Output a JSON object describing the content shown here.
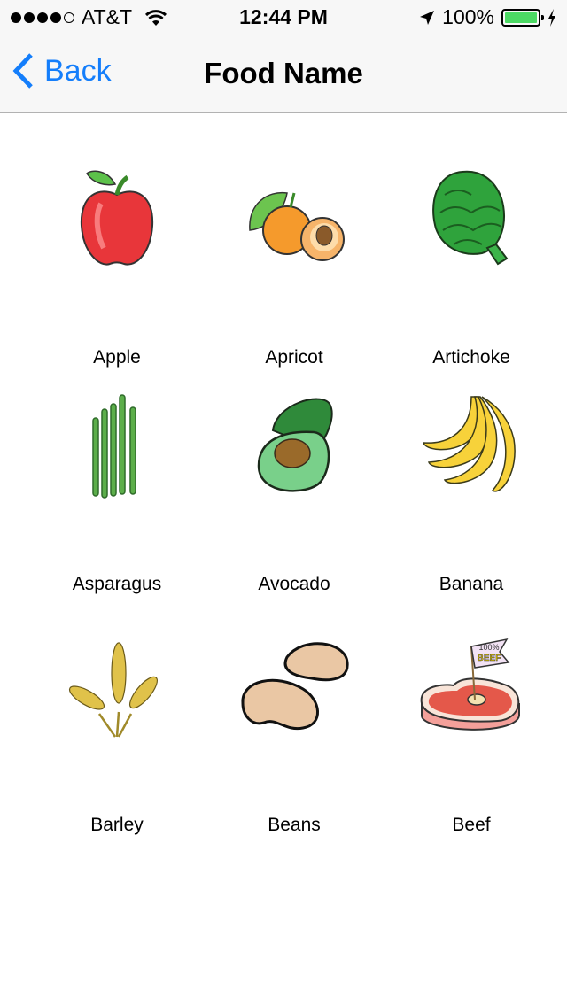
{
  "status_bar": {
    "signal_bars_filled": 4,
    "signal_bars_total": 5,
    "carrier": "AT&T",
    "time": "12:44 PM",
    "battery_percent": "100%",
    "battery_fill": 1.0,
    "battery_color": "#4cd964",
    "charging": true,
    "location_active": true
  },
  "nav": {
    "back_label": "Back",
    "title": "Food Name",
    "accent_color": "#147efb"
  },
  "foods": [
    {
      "label": "Apple",
      "icon": "apple-illustration"
    },
    {
      "label": "Apricot",
      "icon": "apricot-illustration"
    },
    {
      "label": "Artichoke",
      "icon": "artichoke-illustration"
    },
    {
      "label": "Asparagus",
      "icon": "asparagus-illustration"
    },
    {
      "label": "Avocado",
      "icon": "avocado-illustration"
    },
    {
      "label": "Banana",
      "icon": "banana-illustration"
    },
    {
      "label": "Barley",
      "icon": "barley-illustration"
    },
    {
      "label": "Beans",
      "icon": "beans-illustration"
    },
    {
      "label": "Beef",
      "icon": "beef-illustration",
      "flag_text": [
        "100%",
        "BEEF"
      ]
    }
  ]
}
